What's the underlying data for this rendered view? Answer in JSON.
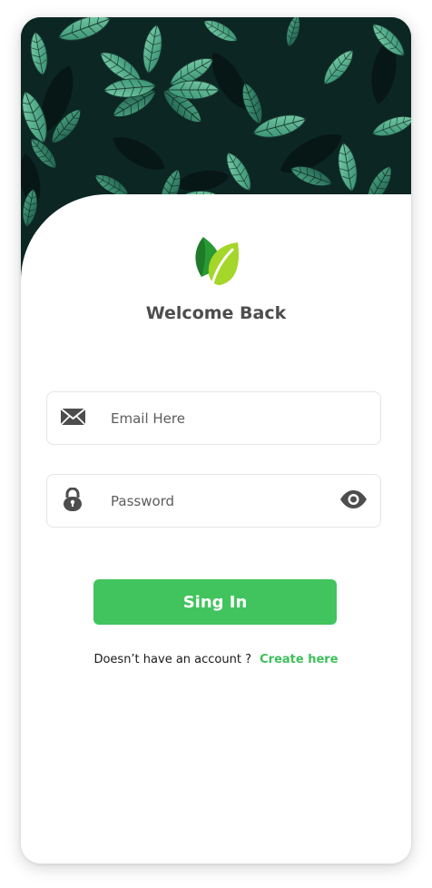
{
  "welcome_title": "Welcome Back",
  "email_field": {
    "placeholder": "Email Here",
    "icon": "envelope-icon"
  },
  "password_field": {
    "placeholder": "Password",
    "icon": "lock-icon",
    "toggle_icon": "eye-icon"
  },
  "signin_button": {
    "label": "Sing In"
  },
  "signup_prompt": {
    "text": "Doesn’t have an account ?",
    "link_label": "Create here"
  },
  "colors": {
    "accent": "#41c45d",
    "link": "#3fbf5a",
    "hero_bg": "#0c2623",
    "leaf_light": "#6fc3a0",
    "leaf_dark": "#2f7a63",
    "logo_dark_green": "#1f7a2a",
    "logo_lime": "#a5d62a"
  }
}
